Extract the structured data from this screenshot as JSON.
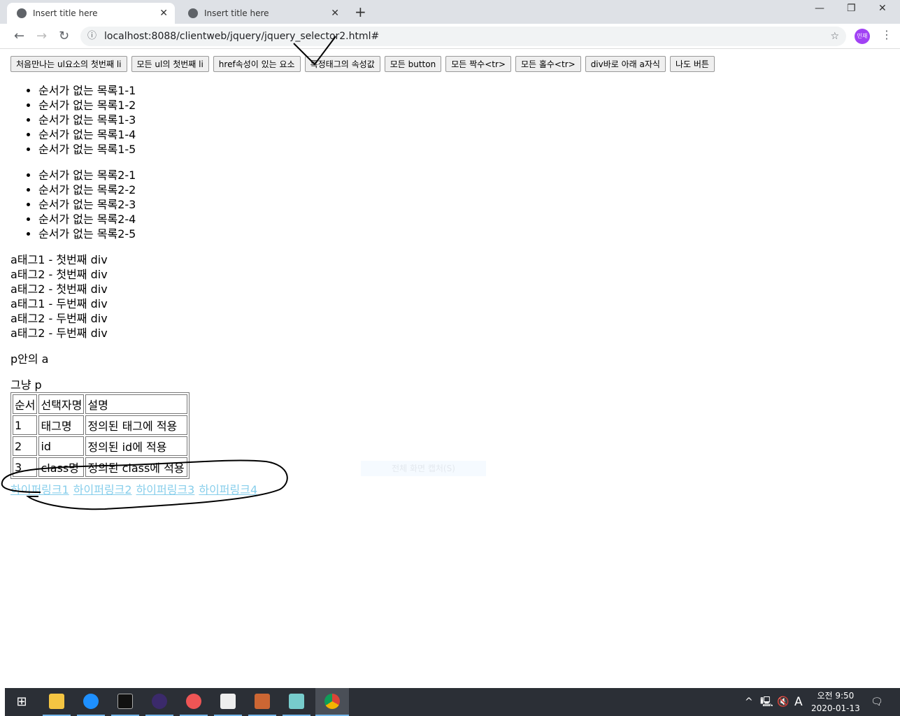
{
  "browser": {
    "tabs": [
      {
        "title": "Insert title here"
      },
      {
        "title": "Insert title here"
      }
    ],
    "url": "localhost:8088/clientweb/jquery/jquery_selector2.html#",
    "profile": "민재"
  },
  "buttons": [
    "처음만나는 ul요소의 첫번째 li",
    "모든 ul의 첫번째 li",
    "href속성이 있는 요소",
    "특정태그의 속성값",
    "모든 button",
    "모든 짝수<tr>",
    "모든 홀수<tr>",
    "div바로 아래 a자식",
    "나도 버튼"
  ],
  "list1": [
    "순서가 없는 목록1-1",
    "순서가 없는 목록1-2",
    "순서가 없는 목록1-3",
    "순서가 없는 목록1-4",
    "순서가 없는 목록1-5"
  ],
  "list2": [
    "순서가 없는 목록2-1",
    "순서가 없는 목록2-2",
    "순서가 없는 목록2-3",
    "순서가 없는 목록2-4",
    "순서가 없는 목록2-5"
  ],
  "divs": [
    "a태그1 - 첫번째 div",
    "a태그2 - 첫번째 div",
    "a태그2 - 첫번째 div",
    "a태그1 - 두번째 div",
    "a태그2 - 두번째 div",
    "a태그2 - 두번째 div"
  ],
  "p1": "p안의 a",
  "p2": "그냥 p",
  "table": {
    "headers": [
      "순서",
      "선택자명",
      "설명"
    ],
    "rows": [
      [
        "1",
        "태그명",
        "정의된 태그에 적용"
      ],
      [
        "2",
        "id",
        "정의된 id에 적용"
      ],
      [
        "3",
        "class명",
        "정의된 class에 적용"
      ]
    ]
  },
  "links": [
    "하이퍼링크1",
    "하이퍼링크2",
    "하이퍼링크3",
    "하이퍼링크4"
  ],
  "capture_tooltip": "전체 화면 캡처(S)",
  "taskbar": {
    "time": "오전 9:50",
    "date": "2020-01-13",
    "ime": "A"
  }
}
